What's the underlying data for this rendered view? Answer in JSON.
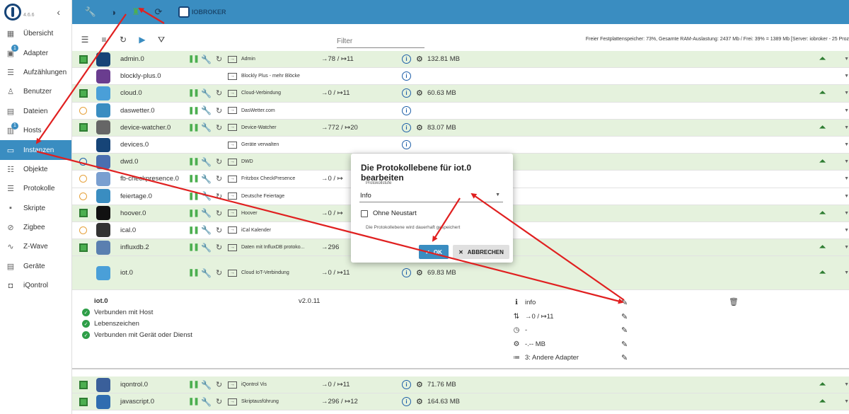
{
  "sidebar": {
    "version": "4.6.6",
    "items": [
      {
        "label": "Übersicht",
        "icon": "grid-icon",
        "glyph": "▦",
        "badge": ""
      },
      {
        "label": "Adapter",
        "icon": "adapter-icon",
        "glyph": "▣",
        "badge": "1"
      },
      {
        "label": "Aufzählungen",
        "icon": "list-icon",
        "glyph": "☰",
        "badge": ""
      },
      {
        "label": "Benutzer",
        "icon": "user-icon",
        "glyph": "♙",
        "badge": ""
      },
      {
        "label": "Dateien",
        "icon": "file-icon",
        "glyph": "▤",
        "badge": ""
      },
      {
        "label": "Hosts",
        "icon": "host-icon",
        "glyph": "▥",
        "badge": "1"
      },
      {
        "label": "Instanzen",
        "icon": "instances-icon",
        "glyph": "▭",
        "badge": ""
      },
      {
        "label": "Objekte",
        "icon": "objects-icon",
        "glyph": "☷",
        "badge": ""
      },
      {
        "label": "Protokolle",
        "icon": "log-icon",
        "glyph": "☰",
        "badge": ""
      },
      {
        "label": "Skripte",
        "icon": "script-icon",
        "glyph": "▪",
        "badge": ""
      },
      {
        "label": "Zigbee",
        "icon": "zigbee-icon",
        "glyph": "⊘",
        "badge": ""
      },
      {
        "label": "Z-Wave",
        "icon": "zwave-icon",
        "glyph": "∿",
        "badge": ""
      },
      {
        "label": "Geräte",
        "icon": "devices-icon",
        "glyph": "▤",
        "badge": ""
      },
      {
        "label": "iQontrol",
        "icon": "iqontrol-icon",
        "glyph": "◘",
        "badge": ""
      }
    ],
    "active_index": 6
  },
  "topbar": {
    "brand": "IOBROKER"
  },
  "toolbar": {
    "filter_placeholder": "Filter",
    "status": "Freier Festplattenspeicher: 73%, Gesamte RAM-Auslastung: 2437 Mb / Frei: 39% = 1389 Mb [Server: iobroker - 25 Proz"
  },
  "instances": [
    {
      "name": "admin.0",
      "title": "Admin",
      "state": "sq",
      "events": "→78 / ↦11",
      "mem": "132.81 MB",
      "green": true,
      "controls": true,
      "color": "#164477",
      "img": "iobroker-logo-icon"
    },
    {
      "name": "blockly-plus.0",
      "title": "Blockly Plus - mehr Blöcke",
      "state": "",
      "events": "",
      "mem": "",
      "green": false,
      "controls": false,
      "color": "#6a3d8f",
      "img": "blockly-icon"
    },
    {
      "name": "cloud.0",
      "title": "Cloud-Verbindung",
      "state": "sq",
      "events": "→0 / ↦11",
      "mem": "60.63 MB",
      "green": true,
      "controls": true,
      "color": "#4a9fd8",
      "img": "cloud-icon"
    },
    {
      "name": "daswetter.0",
      "title": "DasWetter.com",
      "state": "clock",
      "events": "",
      "mem": "",
      "green": false,
      "controls": true,
      "color": "#3a8dc1",
      "img": "weather-icon"
    },
    {
      "name": "device-watcher.0",
      "title": "Device-Watcher",
      "state": "sq",
      "events": "→772 / ↦20",
      "mem": "83.07 MB",
      "green": true,
      "controls": true,
      "color": "#666666",
      "img": "eye-icon"
    },
    {
      "name": "devices.0",
      "title": "Geräte verwalten",
      "state": "",
      "events": "",
      "mem": "",
      "green": false,
      "controls": false,
      "color": "#164477",
      "img": "devices-logo-icon"
    },
    {
      "name": "dwd.0",
      "title": "DWD",
      "state": "clockblue",
      "events": "",
      "mem": "",
      "green": true,
      "controls": true,
      "color": "#4a6fb0",
      "img": "dwd-icon"
    },
    {
      "name": "fb-checkpresence.0",
      "title": "Fritzbox CheckPresence",
      "state": "clock",
      "events": "→0 / ↦",
      "mem": "",
      "green": false,
      "controls": true,
      "color": "#7a9fd0",
      "img": "fritzbox-icon"
    },
    {
      "name": "feiertage.0",
      "title": "Deutsche Feiertage",
      "state": "clock",
      "events": "",
      "mem": "",
      "green": false,
      "controls": true,
      "color": "#3a8dc1",
      "img": "calendar-icon"
    },
    {
      "name": "hoover.0",
      "title": "Hoover",
      "state": "sq",
      "events": "→0 / ↦",
      "mem": "",
      "green": true,
      "controls": true,
      "color": "#111111",
      "img": "hoover-icon"
    },
    {
      "name": "ical.0",
      "title": "iCal Kalender",
      "state": "clock",
      "events": "",
      "mem": "",
      "green": false,
      "controls": true,
      "color": "#333333",
      "img": "ical-icon"
    },
    {
      "name": "influxdb.2",
      "title": "Daten mit InfluxDB protoko...",
      "state": "sq",
      "events": "→296",
      "mem": "",
      "green": true,
      "controls": true,
      "color": "#5a7fb0",
      "img": "influxdb-icon"
    },
    {
      "name": "iot.0",
      "title": "Cloud IoT-Verbindung",
      "state": "",
      "events": "→0 / ↦11",
      "mem": "69.83 MB",
      "green": true,
      "controls": true,
      "color": "#4a9fd8",
      "img": "iot-cloud-icon"
    }
  ],
  "detail": {
    "name": "iot.0",
    "version": "v2.0.11",
    "checks": [
      "Verbunden mit Host",
      "Lebenszeichen",
      "Verbunden mit Gerät oder Dienst"
    ],
    "props": [
      {
        "icon": "info-icon",
        "glyph": "ℹ",
        "value": "info"
      },
      {
        "icon": "events-icon",
        "glyph": "⇅",
        "value": "→0 / ↦11"
      },
      {
        "icon": "schedule-icon",
        "glyph": "◷",
        "value": "-"
      },
      {
        "icon": "ram-icon",
        "glyph": "⚙",
        "value": "-.-- MB"
      },
      {
        "icon": "tier-icon",
        "glyph": "≔",
        "value": "3: Andere Adapter"
      }
    ]
  },
  "bottom_instances": [
    {
      "name": "iqontrol.0",
      "title": "iQontrol Vis",
      "events": "→0 / ↦11",
      "mem": "71.76 MB",
      "color": "#3a5f9a"
    },
    {
      "name": "javascript.0",
      "title": "Skriptausführung",
      "events": "→296 / ↦12",
      "mem": "164.63 MB",
      "color": "#2f6db0"
    }
  ],
  "modal": {
    "title": "Die Protokollebene für iot.0 bearbeiten",
    "field_label": "Protokollstufe",
    "field_value": "Info",
    "checkbox_label": "Ohne Neustart",
    "hint": "Die Protokollebene wird dauerhaft gespeichert",
    "ok_label": "OK",
    "cancel_label": "ABBRECHEN"
  },
  "colors": {
    "accent": "#3a8dc1",
    "running_green": "#4caf50",
    "row_green": "#e5f2dd",
    "annotation_red": "#e02020"
  }
}
